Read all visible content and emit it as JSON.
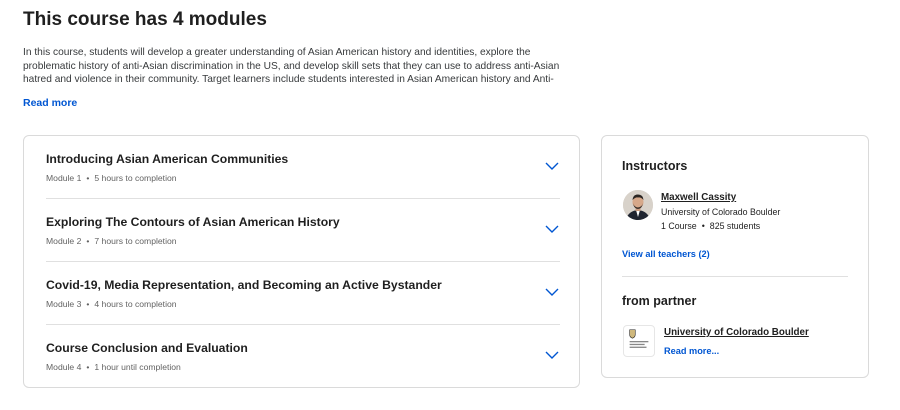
{
  "header": {
    "title": "This course has 4 modules",
    "description": "In this course, students will develop a greater understanding of Asian American history and identities, explore the problematic history of anti-Asian discrimination in the US, and develop skill sets that they can use to address anti-Asian hatred and violence in their community. Target learners include students interested in Asian American history and Anti-Racism, but also any learner interested in",
    "read_more": "Read more"
  },
  "modules": [
    {
      "title": "Introducing Asian American Communities",
      "number": "Module 1",
      "duration": "5 hours to completion"
    },
    {
      "title": "Exploring The Contours of Asian American History",
      "number": "Module 2",
      "duration": "7 hours to completion"
    },
    {
      "title": "Covid-19, Media Representation, and Becoming an Active Bystander",
      "number": "Module 3",
      "duration": "4 hours to completion"
    },
    {
      "title": "Course Conclusion and Evaluation",
      "number": "Module 4",
      "duration": "1 hour until completion"
    }
  ],
  "instructors": {
    "heading": "Instructors",
    "name": "Maxwell Cassity",
    "org": "University of Colorado Boulder",
    "courses": "1 Course",
    "students": "825 students",
    "view_all": "View all teachers (2)"
  },
  "partner": {
    "heading": "from partner",
    "name": "University of Colorado Boulder",
    "read_more": "Read more..."
  },
  "colors": {
    "link": "#0056d2",
    "border": "#dadada",
    "chevron": "#0056d2"
  },
  "icons": {
    "chevron": "chevron-down-icon",
    "logo": "university-logo-icon"
  }
}
